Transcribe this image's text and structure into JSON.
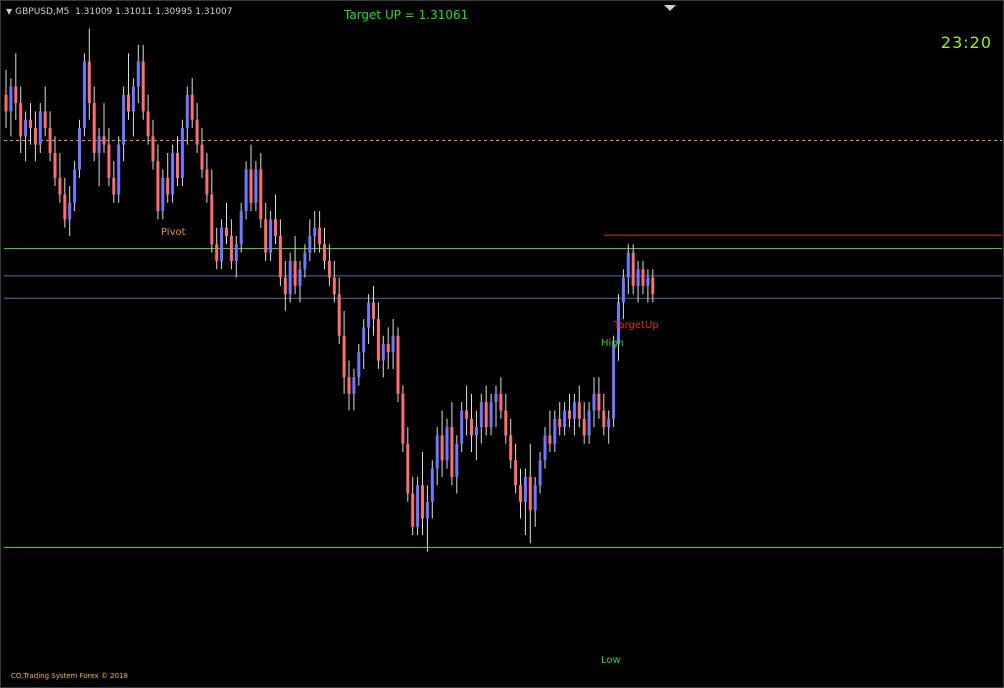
{
  "header": {
    "symbol": "GBPUSD,M5",
    "ohlc": "1.31009 1.31011 1.30995 1.31007"
  },
  "target_text": "Target UP = 1.31061",
  "clock": "23:20",
  "footer": "CO.Trading System Forex © 2018",
  "levels": {
    "pivot": "Pivot",
    "target_up": "TargetUp",
    "high": "High",
    "low": "Low"
  },
  "colors": {
    "background": "#000000",
    "bull_candle": "#6f78ff",
    "bear_candle": "#ff6f6f",
    "wick": "#dcdcdc",
    "pivot_line": "#e8962a",
    "target_line": "#e0282d",
    "high_low_line": "#2ed12e",
    "blue_line": "#4a6fa5",
    "text_green": "#22dd22",
    "clock": "#9ef014"
  },
  "chart_data": {
    "type": "candlestick",
    "price_range": [
      1.3054,
      1.3132
    ],
    "levels": {
      "target_up": 1.31061,
      "high": 1.31045,
      "pivot": 1.31175,
      "blue_upper": 1.31012,
      "blue_lower": 1.30985,
      "low": 1.30685
    },
    "candles": [
      [
        1.3123,
        1.3126,
        1.3119,
        1.3121
      ],
      [
        1.3121,
        1.3125,
        1.3118,
        1.3124
      ],
      [
        1.3124,
        1.3128,
        1.312,
        1.3122
      ],
      [
        1.3122,
        1.3124,
        1.3116,
        1.3118
      ],
      [
        1.3118,
        1.3121,
        1.3115,
        1.312
      ],
      [
        1.312,
        1.3122,
        1.3117,
        1.3119
      ],
      [
        1.3119,
        1.3121,
        1.3115,
        1.3117
      ],
      [
        1.3117,
        1.3122,
        1.3116,
        1.3121
      ],
      [
        1.3121,
        1.3124,
        1.3118,
        1.3119
      ],
      [
        1.3119,
        1.3121,
        1.3115,
        1.3116
      ],
      [
        1.3116,
        1.3118,
        1.3112,
        1.3113
      ],
      [
        1.3113,
        1.3116,
        1.311,
        1.3111
      ],
      [
        1.3111,
        1.3113,
        1.3107,
        1.3108
      ],
      [
        1.3108,
        1.3112,
        1.3106,
        1.311
      ],
      [
        1.311,
        1.3115,
        1.3109,
        1.3114
      ],
      [
        1.3114,
        1.312,
        1.3113,
        1.3119
      ],
      [
        1.3119,
        1.3128,
        1.3118,
        1.3127
      ],
      [
        1.3127,
        1.3131,
        1.312,
        1.3122
      ],
      [
        1.3122,
        1.3124,
        1.3115,
        1.3116
      ],
      [
        1.3116,
        1.3119,
        1.3112,
        1.3118
      ],
      [
        1.3118,
        1.3122,
        1.3116,
        1.3117
      ],
      [
        1.3117,
        1.3119,
        1.3112,
        1.3113
      ],
      [
        1.3113,
        1.3115,
        1.311,
        1.3111
      ],
      [
        1.3111,
        1.3118,
        1.311,
        1.3117
      ],
      [
        1.3117,
        1.3124,
        1.3115,
        1.3123
      ],
      [
        1.3123,
        1.3128,
        1.312,
        1.3121
      ],
      [
        1.3121,
        1.3125,
        1.3118,
        1.3124
      ],
      [
        1.3124,
        1.3129,
        1.3122,
        1.3127
      ],
      [
        1.3127,
        1.3129,
        1.312,
        1.3121
      ],
      [
        1.3121,
        1.3123,
        1.3117,
        1.3118
      ],
      [
        1.3118,
        1.312,
        1.3114,
        1.3115
      ],
      [
        1.3115,
        1.3117,
        1.3108,
        1.3109
      ],
      [
        1.3109,
        1.3114,
        1.3108,
        1.3113
      ],
      [
        1.3113,
        1.3116,
        1.311,
        1.3111
      ],
      [
        1.3111,
        1.3117,
        1.311,
        1.3116
      ],
      [
        1.3116,
        1.3118,
        1.3112,
        1.3113
      ],
      [
        1.3113,
        1.312,
        1.3112,
        1.3119
      ],
      [
        1.3119,
        1.3124,
        1.3117,
        1.3123
      ],
      [
        1.3123,
        1.3125,
        1.3119,
        1.312
      ],
      [
        1.312,
        1.3122,
        1.3116,
        1.3117
      ],
      [
        1.3117,
        1.3119,
        1.3113,
        1.3114
      ],
      [
        1.3114,
        1.3116,
        1.311,
        1.3111
      ],
      [
        1.3111,
        1.3114,
        1.3104,
        1.3105
      ],
      [
        1.3105,
        1.3107,
        1.3102,
        1.3103
      ],
      [
        1.3103,
        1.3108,
        1.3102,
        1.3107
      ],
      [
        1.3107,
        1.311,
        1.3105,
        1.3106
      ],
      [
        1.3106,
        1.3108,
        1.3102,
        1.3103
      ],
      [
        1.3103,
        1.3106,
        1.3101,
        1.3105
      ],
      [
        1.3105,
        1.311,
        1.3104,
        1.3109
      ],
      [
        1.3109,
        1.3115,
        1.3108,
        1.3114
      ],
      [
        1.3114,
        1.3117,
        1.3109,
        1.311
      ],
      [
        1.311,
        1.3115,
        1.3109,
        1.3114
      ],
      [
        1.3114,
        1.3116,
        1.3107,
        1.3108
      ],
      [
        1.3108,
        1.311,
        1.3103,
        1.3104
      ],
      [
        1.3104,
        1.3109,
        1.3103,
        1.3108
      ],
      [
        1.3108,
        1.3111,
        1.3105,
        1.3106
      ],
      [
        1.3106,
        1.3108,
        1.31,
        1.3101
      ],
      [
        1.3101,
        1.3103,
        1.3097,
        1.3099
      ],
      [
        1.3099,
        1.3104,
        1.3098,
        1.3103
      ],
      [
        1.3103,
        1.3106,
        1.3099,
        1.31
      ],
      [
        1.31,
        1.3103,
        1.3098,
        1.3102
      ],
      [
        1.3102,
        1.3105,
        1.3101,
        1.3104
      ],
      [
        1.3104,
        1.3108,
        1.3103,
        1.3106
      ],
      [
        1.3106,
        1.3109,
        1.3104,
        1.3107
      ],
      [
        1.3107,
        1.3109,
        1.3104,
        1.3105
      ],
      [
        1.3105,
        1.3107,
        1.3102,
        1.3103
      ],
      [
        1.3103,
        1.3105,
        1.31,
        1.3101
      ],
      [
        1.3101,
        1.3103,
        1.3098,
        1.3099
      ],
      [
        1.3099,
        1.3101,
        1.3093,
        1.3094
      ],
      [
        1.3094,
        1.3097,
        1.3087,
        1.3089
      ],
      [
        1.3089,
        1.3091,
        1.3085,
        1.3087
      ],
      [
        1.3087,
        1.309,
        1.3085,
        1.3089
      ],
      [
        1.3089,
        1.3093,
        1.3088,
        1.3092
      ],
      [
        1.3092,
        1.3096,
        1.309,
        1.3095
      ],
      [
        1.3095,
        1.3099,
        1.3093,
        1.3098
      ],
      [
        1.3098,
        1.31,
        1.3094,
        1.3096
      ],
      [
        1.3096,
        1.3098,
        1.309,
        1.3091
      ],
      [
        1.3091,
        1.3094,
        1.3089,
        1.3093
      ],
      [
        1.3093,
        1.3095,
        1.309,
        1.3092
      ],
      [
        1.3092,
        1.3096,
        1.309,
        1.3094
      ],
      [
        1.3094,
        1.3095,
        1.3086,
        1.3087
      ],
      [
        1.3087,
        1.3088,
        1.308,
        1.3081
      ],
      [
        1.3081,
        1.3083,
        1.3074,
        1.3075
      ],
      [
        1.3075,
        1.3077,
        1.307,
        1.3071
      ],
      [
        1.3071,
        1.3077,
        1.307,
        1.3076
      ],
      [
        1.3076,
        1.308,
        1.307,
        1.3072
      ],
      [
        1.3072,
        1.3076,
        1.3068,
        1.3074
      ],
      [
        1.3074,
        1.3079,
        1.3072,
        1.3078
      ],
      [
        1.3078,
        1.3083,
        1.3076,
        1.3082
      ],
      [
        1.3082,
        1.3085,
        1.3077,
        1.3079
      ],
      [
        1.3079,
        1.3084,
        1.3078,
        1.3083
      ],
      [
        1.3083,
        1.3086,
        1.3076,
        1.3077
      ],
      [
        1.3077,
        1.3082,
        1.3075,
        1.3081
      ],
      [
        1.3081,
        1.3086,
        1.308,
        1.3085
      ],
      [
        1.3085,
        1.3088,
        1.3082,
        1.3084
      ],
      [
        1.3084,
        1.3087,
        1.308,
        1.3082
      ],
      [
        1.3082,
        1.3085,
        1.3079,
        1.3083
      ],
      [
        1.3083,
        1.3087,
        1.3081,
        1.3086
      ],
      [
        1.3086,
        1.3088,
        1.3082,
        1.3083
      ],
      [
        1.3083,
        1.3087,
        1.3082,
        1.3086
      ],
      [
        1.3086,
        1.3088,
        1.3083,
        1.3087
      ],
      [
        1.3087,
        1.3089,
        1.3084,
        1.3085
      ],
      [
        1.3085,
        1.3087,
        1.3081,
        1.3082
      ],
      [
        1.3082,
        1.3084,
        1.3078,
        1.3079
      ],
      [
        1.3079,
        1.3081,
        1.3075,
        1.3076
      ],
      [
        1.3076,
        1.3078,
        1.3072,
        1.3074
      ],
      [
        1.3074,
        1.3078,
        1.307,
        1.3077
      ],
      [
        1.3077,
        1.3081,
        1.3069,
        1.3073
      ],
      [
        1.3073,
        1.3077,
        1.3071,
        1.3076
      ],
      [
        1.3076,
        1.308,
        1.3075,
        1.3079
      ],
      [
        1.3079,
        1.3083,
        1.3078,
        1.3082
      ],
      [
        1.3082,
        1.3085,
        1.308,
        1.3081
      ],
      [
        1.3081,
        1.3085,
        1.308,
        1.3084
      ],
      [
        1.3084,
        1.3086,
        1.3082,
        1.3083
      ],
      [
        1.3083,
        1.3086,
        1.3082,
        1.3085
      ],
      [
        1.3085,
        1.3087,
        1.3083,
        1.3084
      ],
      [
        1.3084,
        1.3087,
        1.3082,
        1.3086
      ],
      [
        1.3086,
        1.3088,
        1.3083,
        1.3084
      ],
      [
        1.3084,
        1.3086,
        1.3081,
        1.3082
      ],
      [
        1.3082,
        1.3086,
        1.3081,
        1.3085
      ],
      [
        1.3085,
        1.3089,
        1.3083,
        1.3087
      ],
      [
        1.3087,
        1.3089,
        1.3084,
        1.3085
      ],
      [
        1.3085,
        1.3087,
        1.3082,
        1.3083
      ],
      [
        1.3083,
        1.3085,
        1.3081,
        1.3084
      ],
      [
        1.3084,
        1.3094,
        1.3083,
        1.3093
      ],
      [
        1.3093,
        1.3099,
        1.3091,
        1.3098
      ],
      [
        1.3098,
        1.3102,
        1.3096,
        1.3101
      ],
      [
        1.3101,
        1.3105,
        1.3099,
        1.3104
      ],
      [
        1.3104,
        1.3105,
        1.3099,
        1.31
      ],
      [
        1.31,
        1.3103,
        1.3098,
        1.3102
      ],
      [
        1.3102,
        1.3103,
        1.3099,
        1.31
      ],
      [
        1.31,
        1.3102,
        1.3098,
        1.3101
      ],
      [
        1.3101,
        1.3102,
        1.3098,
        1.3099
      ]
    ]
  }
}
